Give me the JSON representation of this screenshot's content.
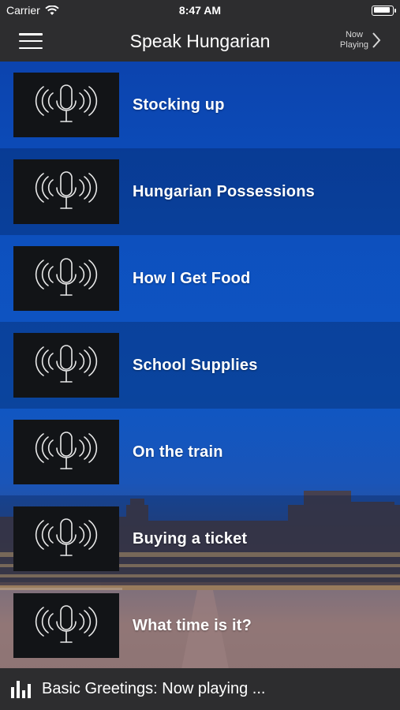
{
  "status": {
    "carrier": "Carrier",
    "time": "8:47 AM",
    "battery_level": 0.95
  },
  "nav": {
    "title": "Speak Hungarian",
    "now_playing_line1": "Now",
    "now_playing_line2": "Playing"
  },
  "lessons": [
    {
      "label": "Stocking up",
      "icon": "microphone-icon"
    },
    {
      "label": "Hungarian Possessions",
      "icon": "microphone-icon"
    },
    {
      "label": "How I Get Food",
      "icon": "microphone-icon"
    },
    {
      "label": "School Supplies",
      "icon": "microphone-icon"
    },
    {
      "label": "On the train",
      "icon": "microphone-icon"
    },
    {
      "label": "Buying a ticket",
      "icon": "microphone-icon"
    },
    {
      "label": "What time is it?",
      "icon": "microphone-icon"
    }
  ],
  "player": {
    "text": "Basic Greetings: Now playing ..."
  },
  "colors": {
    "bar": "#2d2d2f",
    "thumb": "#121417",
    "accent_blue": "#0e56c4"
  }
}
